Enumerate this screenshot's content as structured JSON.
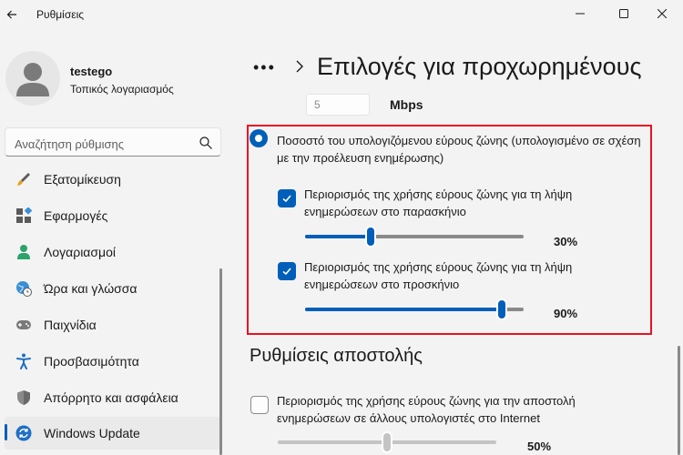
{
  "window": {
    "title": "Ρυθμίσεις"
  },
  "profile": {
    "name": "testego",
    "account_type": "Τοπικός λογαριασμός"
  },
  "search": {
    "placeholder": "Αναζήτηση ρύθμισης"
  },
  "sidebar": {
    "items": [
      {
        "label": "Εξατομίκευση",
        "icon": "brush-icon"
      },
      {
        "label": "Εφαρμογές",
        "icon": "apps-icon"
      },
      {
        "label": "Λογαριασμοί",
        "icon": "person-icon"
      },
      {
        "label": "Ώρα και γλώσσα",
        "icon": "globe-clock-icon"
      },
      {
        "label": "Παιχνίδια",
        "icon": "gamepad-icon"
      },
      {
        "label": "Προσβασιμότητα",
        "icon": "accessibility-icon"
      },
      {
        "label": "Απόρρητο και ασφάλεια",
        "icon": "shield-icon"
      },
      {
        "label": "Windows Update",
        "icon": "update-icon",
        "active": true
      }
    ]
  },
  "header": {
    "dots": "•••",
    "title": "Επιλογές για προχωρημένους"
  },
  "download": {
    "mbps_value": "5",
    "mbps_unit": "Mbps",
    "percentage_option": {
      "label": "Ποσοστό του υπολογιζόμενου εύρους ζώνης (υπολογισμένο σε σχέση με την προέλευση ενημέρωσης)",
      "selected": true
    },
    "background": {
      "label": "Περιορισμός της χρήσης εύρους ζώνης για τη λήψη ενημερώσεων στο παρασκήνιο",
      "checked": true,
      "value": 30,
      "value_text": "30%"
    },
    "foreground": {
      "label": "Περιορισμός της χρήσης εύρους ζώνης για τη λήψη ενημερώσεων στο προσκήνιο",
      "checked": true,
      "value": 90,
      "value_text": "90%"
    }
  },
  "upload": {
    "section_title": "Ρυθμίσεις αποστολής",
    "limit": {
      "label": "Περιορισμός της χρήσης εύρους ζώνης για την αποστολή ενημερώσεων σε άλλους υπολογιστές στο Internet",
      "checked": false,
      "value": 50,
      "value_text": "50%"
    }
  },
  "colors": {
    "accent": "#005fb8",
    "highlight_border": "#e81123",
    "background": "#f3f3f3"
  }
}
